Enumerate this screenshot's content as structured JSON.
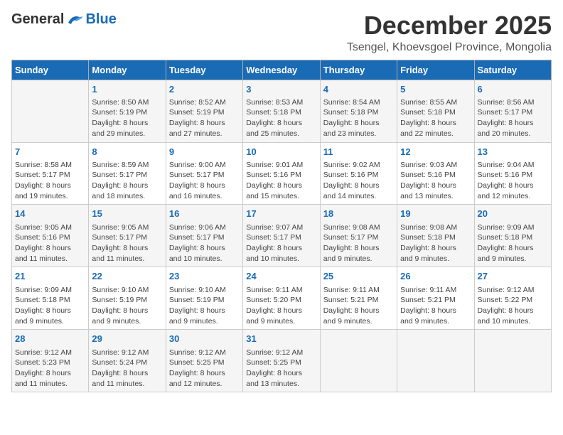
{
  "logo": {
    "general": "General",
    "blue": "Blue"
  },
  "title": "December 2025",
  "subtitle": "Tsengel, Khoevsgoel Province, Mongolia",
  "days_of_week": [
    "Sunday",
    "Monday",
    "Tuesday",
    "Wednesday",
    "Thursday",
    "Friday",
    "Saturday"
  ],
  "weeks": [
    [
      {
        "day": "",
        "info": ""
      },
      {
        "day": "1",
        "info": "Sunrise: 8:50 AM\nSunset: 5:19 PM\nDaylight: 8 hours\nand 29 minutes."
      },
      {
        "day": "2",
        "info": "Sunrise: 8:52 AM\nSunset: 5:19 PM\nDaylight: 8 hours\nand 27 minutes."
      },
      {
        "day": "3",
        "info": "Sunrise: 8:53 AM\nSunset: 5:18 PM\nDaylight: 8 hours\nand 25 minutes."
      },
      {
        "day": "4",
        "info": "Sunrise: 8:54 AM\nSunset: 5:18 PM\nDaylight: 8 hours\nand 23 minutes."
      },
      {
        "day": "5",
        "info": "Sunrise: 8:55 AM\nSunset: 5:18 PM\nDaylight: 8 hours\nand 22 minutes."
      },
      {
        "day": "6",
        "info": "Sunrise: 8:56 AM\nSunset: 5:17 PM\nDaylight: 8 hours\nand 20 minutes."
      }
    ],
    [
      {
        "day": "7",
        "info": "Sunrise: 8:58 AM\nSunset: 5:17 PM\nDaylight: 8 hours\nand 19 minutes."
      },
      {
        "day": "8",
        "info": "Sunrise: 8:59 AM\nSunset: 5:17 PM\nDaylight: 8 hours\nand 18 minutes."
      },
      {
        "day": "9",
        "info": "Sunrise: 9:00 AM\nSunset: 5:17 PM\nDaylight: 8 hours\nand 16 minutes."
      },
      {
        "day": "10",
        "info": "Sunrise: 9:01 AM\nSunset: 5:16 PM\nDaylight: 8 hours\nand 15 minutes."
      },
      {
        "day": "11",
        "info": "Sunrise: 9:02 AM\nSunset: 5:16 PM\nDaylight: 8 hours\nand 14 minutes."
      },
      {
        "day": "12",
        "info": "Sunrise: 9:03 AM\nSunset: 5:16 PM\nDaylight: 8 hours\nand 13 minutes."
      },
      {
        "day": "13",
        "info": "Sunrise: 9:04 AM\nSunset: 5:16 PM\nDaylight: 8 hours\nand 12 minutes."
      }
    ],
    [
      {
        "day": "14",
        "info": "Sunrise: 9:05 AM\nSunset: 5:16 PM\nDaylight: 8 hours\nand 11 minutes."
      },
      {
        "day": "15",
        "info": "Sunrise: 9:05 AM\nSunset: 5:17 PM\nDaylight: 8 hours\nand 11 minutes."
      },
      {
        "day": "16",
        "info": "Sunrise: 9:06 AM\nSunset: 5:17 PM\nDaylight: 8 hours\nand 10 minutes."
      },
      {
        "day": "17",
        "info": "Sunrise: 9:07 AM\nSunset: 5:17 PM\nDaylight: 8 hours\nand 10 minutes."
      },
      {
        "day": "18",
        "info": "Sunrise: 9:08 AM\nSunset: 5:17 PM\nDaylight: 8 hours\nand 9 minutes."
      },
      {
        "day": "19",
        "info": "Sunrise: 9:08 AM\nSunset: 5:18 PM\nDaylight: 8 hours\nand 9 minutes."
      },
      {
        "day": "20",
        "info": "Sunrise: 9:09 AM\nSunset: 5:18 PM\nDaylight: 8 hours\nand 9 minutes."
      }
    ],
    [
      {
        "day": "21",
        "info": "Sunrise: 9:09 AM\nSunset: 5:18 PM\nDaylight: 8 hours\nand 9 minutes."
      },
      {
        "day": "22",
        "info": "Sunrise: 9:10 AM\nSunset: 5:19 PM\nDaylight: 8 hours\nand 9 minutes."
      },
      {
        "day": "23",
        "info": "Sunrise: 9:10 AM\nSunset: 5:19 PM\nDaylight: 8 hours\nand 9 minutes."
      },
      {
        "day": "24",
        "info": "Sunrise: 9:11 AM\nSunset: 5:20 PM\nDaylight: 8 hours\nand 9 minutes."
      },
      {
        "day": "25",
        "info": "Sunrise: 9:11 AM\nSunset: 5:21 PM\nDaylight: 8 hours\nand 9 minutes."
      },
      {
        "day": "26",
        "info": "Sunrise: 9:11 AM\nSunset: 5:21 PM\nDaylight: 8 hours\nand 9 minutes."
      },
      {
        "day": "27",
        "info": "Sunrise: 9:12 AM\nSunset: 5:22 PM\nDaylight: 8 hours\nand 10 minutes."
      }
    ],
    [
      {
        "day": "28",
        "info": "Sunrise: 9:12 AM\nSunset: 5:23 PM\nDaylight: 8 hours\nand 11 minutes."
      },
      {
        "day": "29",
        "info": "Sunrise: 9:12 AM\nSunset: 5:24 PM\nDaylight: 8 hours\nand 11 minutes."
      },
      {
        "day": "30",
        "info": "Sunrise: 9:12 AM\nSunset: 5:25 PM\nDaylight: 8 hours\nand 12 minutes."
      },
      {
        "day": "31",
        "info": "Sunrise: 9:12 AM\nSunset: 5:25 PM\nDaylight: 8 hours\nand 13 minutes."
      },
      {
        "day": "",
        "info": ""
      },
      {
        "day": "",
        "info": ""
      },
      {
        "day": "",
        "info": ""
      }
    ]
  ]
}
